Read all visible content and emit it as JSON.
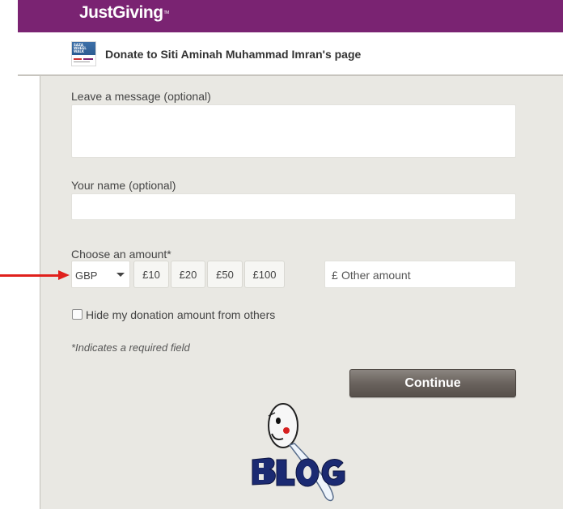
{
  "header": {
    "brand": "JustGiving",
    "brand_tm": "TM"
  },
  "subheader": {
    "title": "Donate to Siti Aminah Muhammad Imran's page",
    "thumb_text": "SAZA WHEEL WALK"
  },
  "form": {
    "message_label": "Leave a message (optional)",
    "message_value": "",
    "name_label": "Your name (optional)",
    "name_value": "",
    "amount_label": "Choose an amount*",
    "currency": {
      "selected": "GBP"
    },
    "amount_buttons": [
      "£10",
      "£20",
      "£50",
      "£100"
    ],
    "other_amount": {
      "currency_symbol": "£",
      "placeholder": "Other amount"
    },
    "hide_amount_label": "Hide my donation amount from others",
    "hide_amount_checked": false,
    "required_note": "*Indicates a required field",
    "continue_label": "Continue"
  },
  "watermark": {
    "text": "BLOG"
  },
  "colors": {
    "header_bg": "#7a2372",
    "panel_bg": "#e9e8e3",
    "continue_bg": "#6a635e",
    "annotation_arrow": "#e0201c"
  }
}
